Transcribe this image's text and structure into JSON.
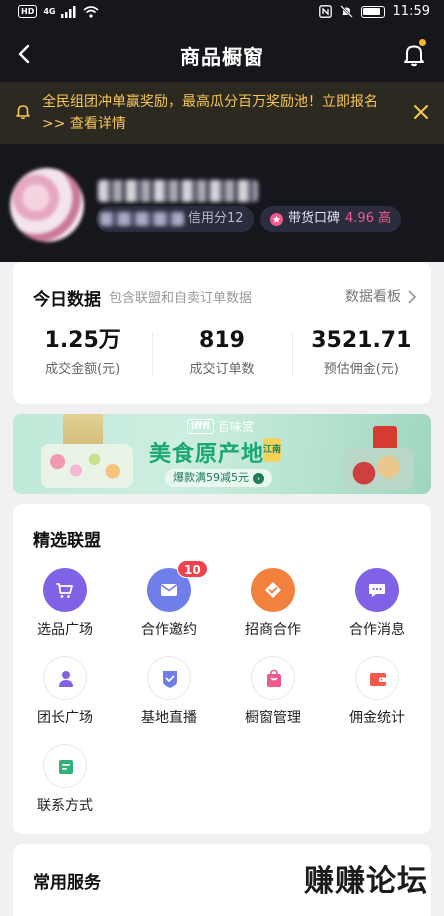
{
  "status_bar": {
    "hd": "HD",
    "network": "4G",
    "time": "11:59"
  },
  "nav": {
    "title": "商品橱窗"
  },
  "notice": {
    "text": "全民组团冲单赢奖励，最高瓜分百万奖励池！立即报名 >> 查看详情"
  },
  "profile": {
    "score_label": "信用分12",
    "reputation_label": "带货口碑",
    "reputation_value": "4.96 高"
  },
  "today": {
    "title": "今日数据",
    "subtitle": "包含联盟和自卖订单数据",
    "board_link": "数据看板",
    "stats": [
      {
        "value": "1.25万",
        "label": "成交金额(元)"
      },
      {
        "value": "819",
        "label": "成交订单数"
      },
      {
        "value": "3521.71",
        "label": "预估佣金(元)"
      }
    ]
  },
  "banner": {
    "brand": "百味赏",
    "brand_box": "ifffl",
    "title": "美食原产地",
    "badge": "江南",
    "promo": "爆款满59减5元"
  },
  "alliance": {
    "title": "精选联盟",
    "items": [
      {
        "label": "选品广场",
        "icon": "cart-icon"
      },
      {
        "label": "合作邀约",
        "icon": "envelope-icon",
        "badge": "10"
      },
      {
        "label": "招商合作",
        "icon": "handshake-icon"
      },
      {
        "label": "合作消息",
        "icon": "chat-icon"
      },
      {
        "label": "团长广场",
        "icon": "person-icon"
      },
      {
        "label": "基地直播",
        "icon": "shield-check-icon"
      },
      {
        "label": "橱窗管理",
        "icon": "shopping-bag-icon"
      },
      {
        "label": "佣金统计",
        "icon": "wallet-icon"
      },
      {
        "label": "联系方式",
        "icon": "contact-card-icon"
      }
    ]
  },
  "services": {
    "title": "常用服务"
  },
  "watermark": "赚赚论坛",
  "colors": {
    "header_bg": "#16161d",
    "notice_text": "#f6c65a",
    "reputation_accent": "#f0598b",
    "badge_red": "#f0414d"
  }
}
